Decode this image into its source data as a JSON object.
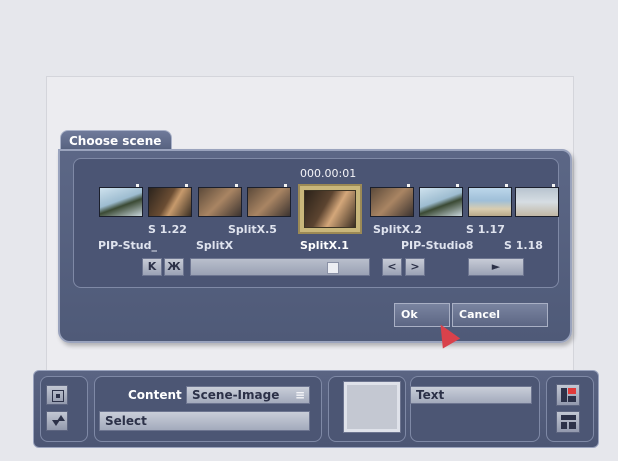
{
  "dialog": {
    "title": "Choose scene",
    "timecode": "000.00:01",
    "upper_labels": [
      "S 1.22",
      "SplitX.5",
      "SplitX.2",
      "S 1.17"
    ],
    "lower_labels": [
      "PIP-Stud_",
      "SplitX",
      "SplitX.1",
      "PIP-Studio8",
      "S 1.18"
    ],
    "nav": {
      "first": "K",
      "last": "Ж",
      "prev": "<",
      "next": ">",
      "play": "►"
    },
    "ok_label": "Ok",
    "cancel_label": "Cancel"
  },
  "toolbar": {
    "content_label": "Content",
    "content_value": "Scene-Image",
    "select_label": "Select",
    "text_label": "Text"
  },
  "colors": {
    "panel": "#55607f",
    "cursor": "#d9414b",
    "layout_icon_accent": "#e03a3a"
  }
}
